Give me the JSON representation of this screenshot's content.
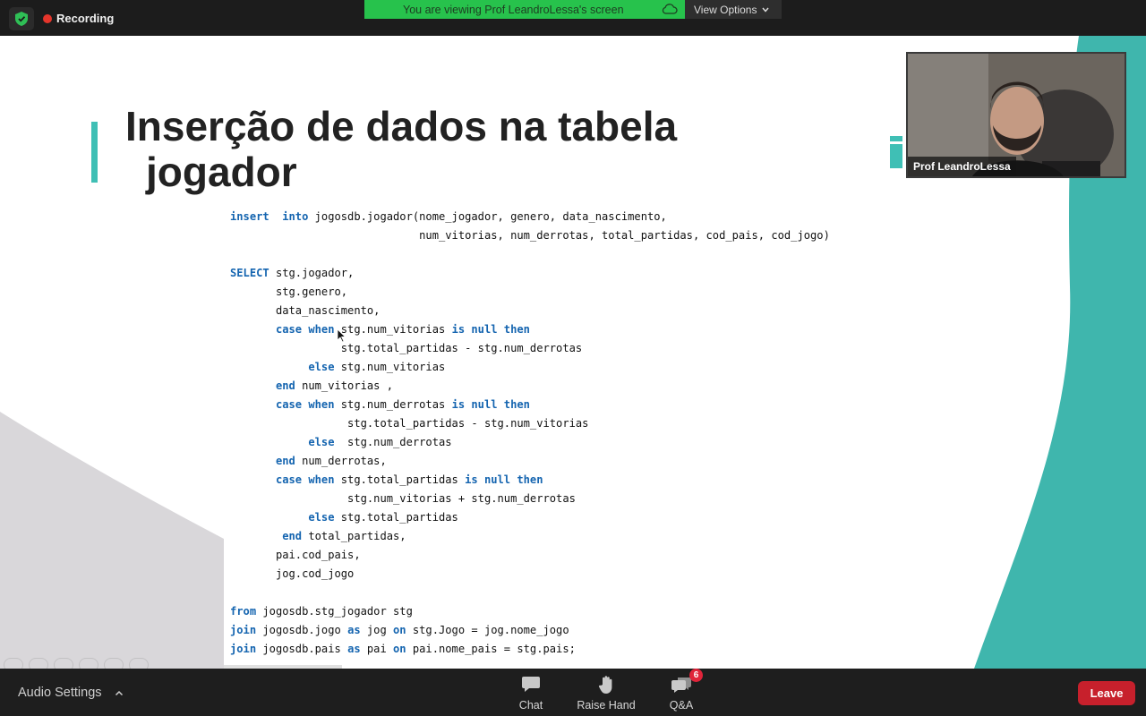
{
  "topbar": {
    "recording_label": "Recording",
    "viewing_text": "You are viewing Prof LeandroLessa's screen",
    "view_options_label": "View Options",
    "colors": {
      "viewing_bg": "#27c24c",
      "recording_dot": "#e5352b"
    }
  },
  "slide": {
    "title_line1": "Inserção de dados na tabela",
    "title_line2": "jogador",
    "accent_color": "#3fbfb5",
    "code_lines": [
      [
        {
          "k": 1,
          "t": "insert"
        },
        {
          "k": 0,
          "t": "  "
        },
        {
          "k": 1,
          "t": "into"
        },
        {
          "k": 0,
          "t": " jogosdb.jogador(nome_jogador, genero, data_nascimento,"
        }
      ],
      [
        {
          "k": 0,
          "t": "                             num_vitorias, num_derrotas, total_partidas, cod_pais, cod_jogo)"
        }
      ],
      [
        {
          "k": 0,
          "t": ""
        }
      ],
      [
        {
          "k": 1,
          "t": "SELECT"
        },
        {
          "k": 0,
          "t": " stg.jogador,"
        }
      ],
      [
        {
          "k": 0,
          "t": "       stg.genero,"
        }
      ],
      [
        {
          "k": 0,
          "t": "       data_nascimento,"
        }
      ],
      [
        {
          "k": 0,
          "t": "       "
        },
        {
          "k": 1,
          "t": "case when"
        },
        {
          "k": 0,
          "t": " stg.num_vitorias "
        },
        {
          "k": 1,
          "t": "is null then"
        }
      ],
      [
        {
          "k": 0,
          "t": "                 stg.total_partidas - stg.num_derrotas"
        }
      ],
      [
        {
          "k": 0,
          "t": "            "
        },
        {
          "k": 1,
          "t": "else"
        },
        {
          "k": 0,
          "t": " stg.num_vitorias"
        }
      ],
      [
        {
          "k": 0,
          "t": "       "
        },
        {
          "k": 1,
          "t": "end"
        },
        {
          "k": 0,
          "t": " num_vitorias ,"
        }
      ],
      [
        {
          "k": 0,
          "t": "       "
        },
        {
          "k": 1,
          "t": "case when"
        },
        {
          "k": 0,
          "t": " stg.num_derrotas "
        },
        {
          "k": 1,
          "t": "is null then"
        }
      ],
      [
        {
          "k": 0,
          "t": "                  stg.total_partidas - stg.num_vitorias"
        }
      ],
      [
        {
          "k": 0,
          "t": "            "
        },
        {
          "k": 1,
          "t": "else"
        },
        {
          "k": 0,
          "t": "  stg.num_derrotas"
        }
      ],
      [
        {
          "k": 0,
          "t": "       "
        },
        {
          "k": 1,
          "t": "end"
        },
        {
          "k": 0,
          "t": " num_derrotas,"
        }
      ],
      [
        {
          "k": 0,
          "t": "       "
        },
        {
          "k": 1,
          "t": "case when"
        },
        {
          "k": 0,
          "t": " stg.total_partidas "
        },
        {
          "k": 1,
          "t": "is null then"
        }
      ],
      [
        {
          "k": 0,
          "t": "                  stg.num_vitorias + stg.num_derrotas"
        }
      ],
      [
        {
          "k": 0,
          "t": "            "
        },
        {
          "k": 1,
          "t": "else"
        },
        {
          "k": 0,
          "t": " stg.total_partidas"
        }
      ],
      [
        {
          "k": 0,
          "t": "        "
        },
        {
          "k": 1,
          "t": "end"
        },
        {
          "k": 0,
          "t": " total_partidas,"
        }
      ],
      [
        {
          "k": 0,
          "t": "       pai.cod_pais,"
        }
      ],
      [
        {
          "k": 0,
          "t": "       jog.cod_jogo"
        }
      ],
      [
        {
          "k": 0,
          "t": ""
        }
      ],
      [
        {
          "k": 1,
          "t": "from"
        },
        {
          "k": 0,
          "t": " jogosdb.stg_jogador stg"
        }
      ],
      [
        {
          "k": 1,
          "t": "join"
        },
        {
          "k": 0,
          "t": " jogosdb.jogo "
        },
        {
          "k": 1,
          "t": "as"
        },
        {
          "k": 0,
          "t": " jog "
        },
        {
          "k": 1,
          "t": "on"
        },
        {
          "k": 0,
          "t": " stg.Jogo = jog.nome_jogo"
        }
      ],
      [
        {
          "k": 1,
          "t": "join"
        },
        {
          "k": 0,
          "t": " jogosdb.pais "
        },
        {
          "k": 1,
          "t": "as"
        },
        {
          "k": 0,
          "t": " pai "
        },
        {
          "k": 1,
          "t": "on"
        },
        {
          "k": 0,
          "t": " pai.nome_pais = stg.pais;"
        }
      ]
    ]
  },
  "video": {
    "participant_name": "Prof LeandroLessa"
  },
  "bottombar": {
    "audio_settings_label": "Audio Settings",
    "chat_label": "Chat",
    "raise_hand_label": "Raise Hand",
    "qa_label": "Q&A",
    "qa_badge": "6",
    "leave_label": "Leave",
    "leave_color": "#c7202c"
  }
}
